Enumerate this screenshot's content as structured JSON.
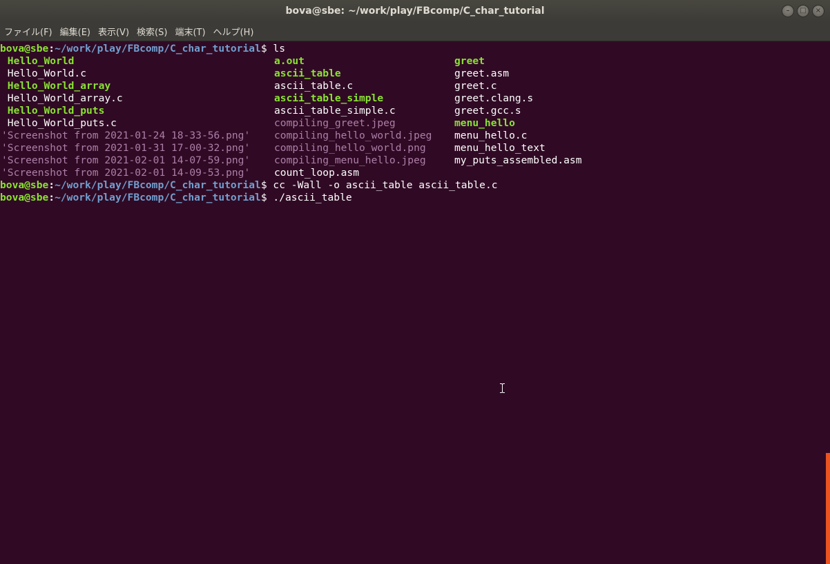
{
  "window": {
    "title": "bova@sbe: ~/work/play/FBcomp/C_char_tutorial"
  },
  "menu": {
    "items": [
      "ファイル(F)",
      "編集(E)",
      "表示(V)",
      "検索(S)",
      "端末(T)",
      "ヘルプ(H)"
    ]
  },
  "prompt": {
    "user": "bova@sbe",
    "colon": ":",
    "path": "~/work/play/FBcomp/C_char_tutorial",
    "dollar": "$"
  },
  "commands": [
    "ls",
    "cc -Wall -o ascii_table ascii_table.c",
    "./ascii_table"
  ],
  "ls_output": {
    "rows": [
      [
        {
          "t": " Hello_World",
          "k": "exe"
        },
        {
          "t": "a.out",
          "k": "exe"
        },
        {
          "t": "greet",
          "k": "exe"
        }
      ],
      [
        {
          "t": " Hello_World.c",
          "k": "plain"
        },
        {
          "t": "ascii_table",
          "k": "exe"
        },
        {
          "t": "greet.asm",
          "k": "plain"
        }
      ],
      [
        {
          "t": " Hello_World_array",
          "k": "exe"
        },
        {
          "t": "ascii_table.c",
          "k": "plain"
        },
        {
          "t": "greet.c",
          "k": "plain"
        }
      ],
      [
        {
          "t": " Hello_World_array.c",
          "k": "plain"
        },
        {
          "t": "ascii_table_simple",
          "k": "exe"
        },
        {
          "t": "greet.clang.s",
          "k": "plain"
        }
      ],
      [
        {
          "t": " Hello_World_puts",
          "k": "exe"
        },
        {
          "t": "ascii_table_simple.c",
          "k": "plain"
        },
        {
          "t": "greet.gcc.s",
          "k": "plain"
        }
      ],
      [
        {
          "t": " Hello_World_puts.c",
          "k": "plain"
        },
        {
          "t": "compiling_greet.jpeg",
          "k": "img"
        },
        {
          "t": "menu_hello",
          "k": "exe"
        }
      ],
      [
        {
          "t": "'Screenshot from 2021-01-24 18-33-56.png'",
          "k": "img-b"
        },
        {
          "t": "compiling_hello_world.jpeg",
          "k": "img"
        },
        {
          "t": "menu_hello.c",
          "k": "plain"
        }
      ],
      [
        {
          "t": "'Screenshot from 2021-01-31 17-00-32.png'",
          "k": "img-b"
        },
        {
          "t": "compiling_hello_world.png",
          "k": "img"
        },
        {
          "t": "menu_hello_text",
          "k": "plain"
        }
      ],
      [
        {
          "t": "'Screenshot from 2021-02-01 14-07-59.png'",
          "k": "img-b"
        },
        {
          "t": "compiling_menu_hello.jpeg",
          "k": "img"
        },
        {
          "t": "my_puts_assembled.asm",
          "k": "plain"
        }
      ],
      [
        {
          "t": "'Screenshot from 2021-02-01 14-09-53.png'",
          "k": "img-b"
        },
        {
          "t": "count_loop.asm",
          "k": "plain"
        },
        {
          "t": "",
          "k": "plain"
        }
      ]
    ]
  },
  "colors": {
    "background": "#300a24",
    "prompt_user": "#8ae234",
    "prompt_path": "#729fcf",
    "executable": "#8ae234",
    "image_file": "#ad7fa8",
    "text": "#ffffff",
    "scroll_accent": "#e95420"
  },
  "icons": {
    "minimize": "minimize-icon",
    "maximize": "maximize-icon",
    "close": "close-icon",
    "cursor": "ibeam-cursor-icon"
  }
}
